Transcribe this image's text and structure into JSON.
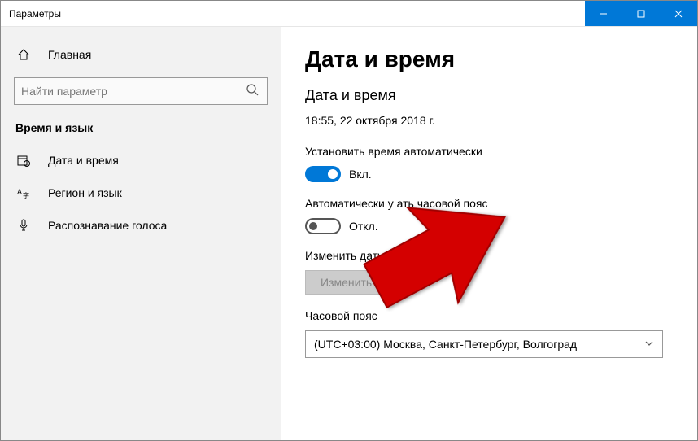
{
  "window": {
    "title": "Параметры"
  },
  "sidebar": {
    "home": "Главная",
    "search_placeholder": "Найти параметр",
    "category": "Время и язык",
    "items": [
      {
        "label": "Дата и время"
      },
      {
        "label": "Регион и язык"
      },
      {
        "label": "Распознавание голоса"
      }
    ]
  },
  "content": {
    "heading": "Дата и время",
    "subheading": "Дата и время",
    "current": "18:55, 22 октября 2018 г.",
    "auto_time_label": "Установить время автоматически",
    "auto_time_state": "Вкл.",
    "auto_tz_label": "Автоматически у                      ать часовой пояс",
    "auto_tz_state": "Откл.",
    "change_label": "Изменить дату и время",
    "change_button": "Изменить",
    "tz_label": "Часовой пояс",
    "tz_value": "(UTC+03:00) Москва, Санкт-Петербург, Волгоград"
  }
}
